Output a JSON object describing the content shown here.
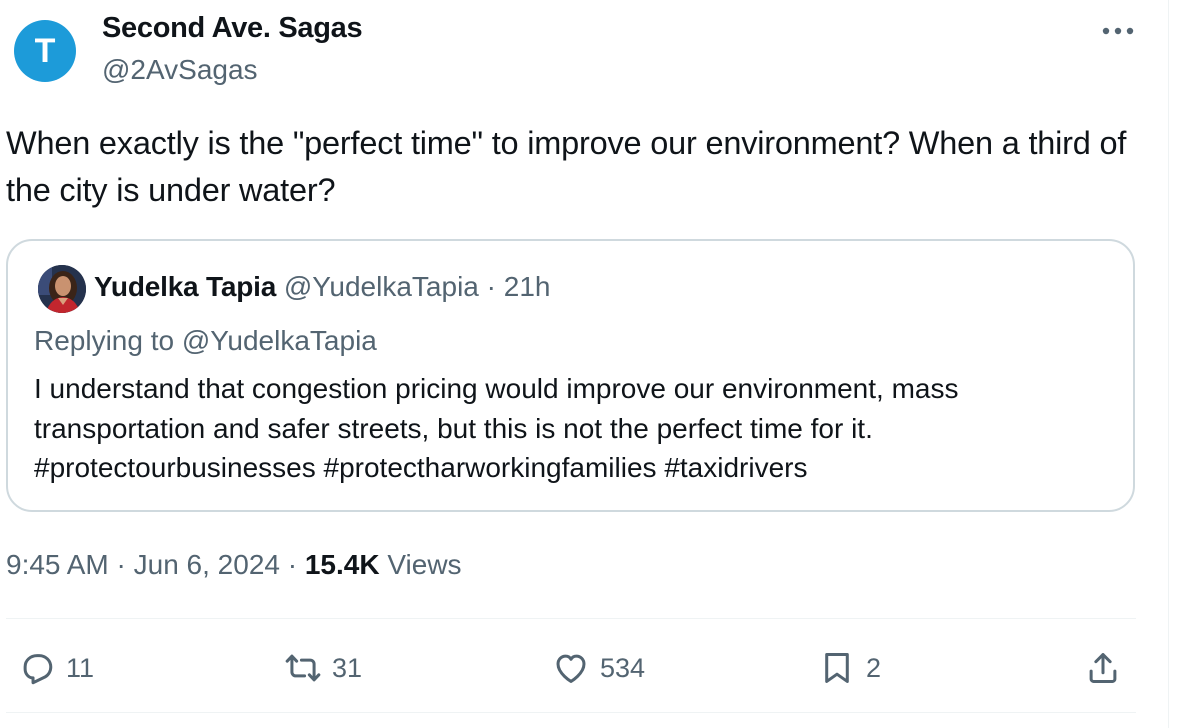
{
  "tweet": {
    "author": {
      "avatar_letter": "T",
      "name": "Second Ave. Sagas",
      "handle": "@2AvSagas",
      "avatar_color": "#1d9bd9"
    },
    "text": "When exactly is the \"perfect time\" to improve our environment? When a third of the city is under water?",
    "more_icon": "ellipsis-icon"
  },
  "quote": {
    "name": "Yudelka Tapia",
    "handle": "@YudelkaTapia",
    "separator": "·",
    "time": "21h",
    "replying_to": "Replying to @YudelkaTapia",
    "text": "I understand that congestion pricing would improve our environment, mass transportation and safer streets, but this is not the perfect time for it. #protectourbusinesses #protectharworkingfamilies #taxidrivers"
  },
  "meta": {
    "time": "9:45 AM",
    "sep1": "·",
    "date": "Jun 6, 2024",
    "sep2": "·",
    "views_count": "15.4K",
    "views_label": "Views"
  },
  "actions": {
    "replies": "11",
    "retweets": "31",
    "likes": "534",
    "bookmarks": "2",
    "icons": [
      "reply-icon",
      "retweet-icon",
      "like-icon",
      "bookmark-icon",
      "share-icon"
    ]
  },
  "colors": {
    "text": "#0f1419",
    "secondary": "#536471",
    "border": "#cfd9de",
    "divider": "#eff3f4"
  }
}
